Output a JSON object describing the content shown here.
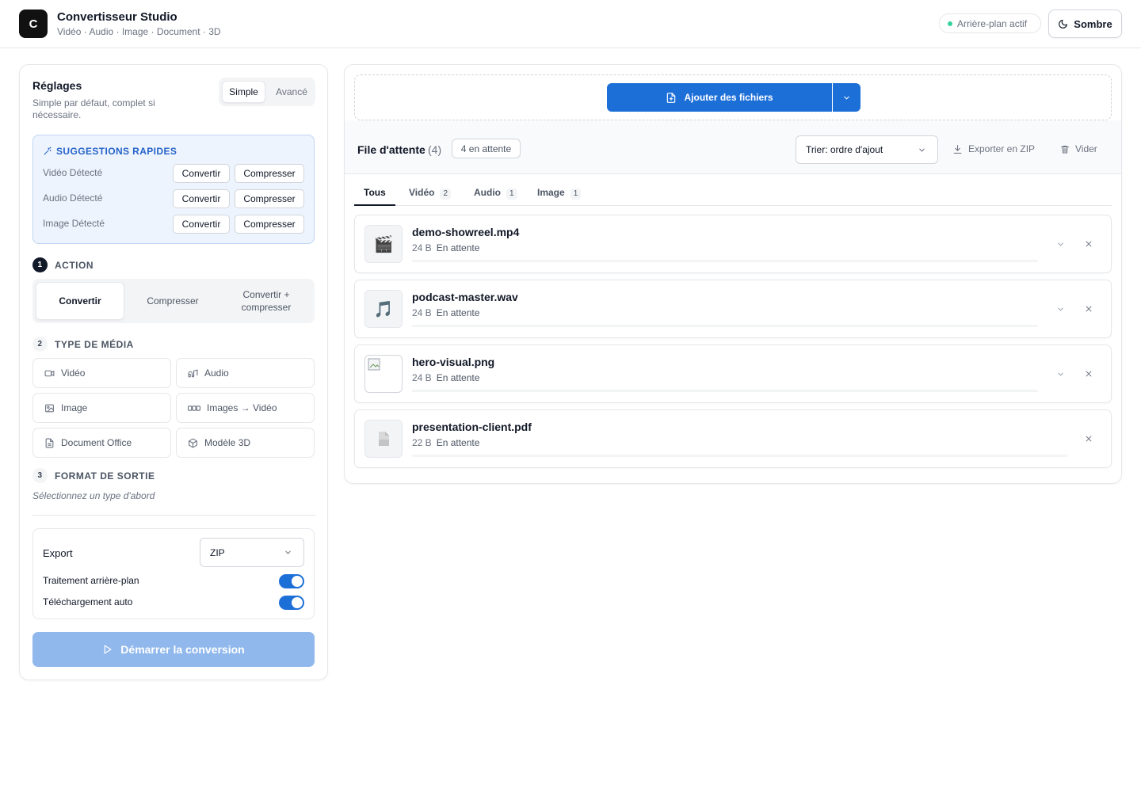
{
  "header": {
    "logo_letter": "C",
    "title": "Convertisseur Studio",
    "subtitle": "Vidéo · Audio · Image · Document · 3D",
    "background_status": "Arrière-plan actif",
    "theme_button": "Sombre"
  },
  "settings": {
    "title": "Réglages",
    "description": "Simple par défaut, complet si nécessaire.",
    "modes": [
      "Simple",
      "Avancé"
    ],
    "selected_mode": "Simple",
    "suggestions": {
      "title": "SUGGESTIONS RAPIDES",
      "rows": [
        {
          "label": "Vidéo Détecté",
          "convert": "Convertir",
          "compress": "Compresser"
        },
        {
          "label": "Audio Détecté",
          "convert": "Convertir",
          "compress": "Compresser"
        },
        {
          "label": "Image Détecté",
          "convert": "Convertir",
          "compress": "Compresser"
        }
      ]
    },
    "steps": [
      {
        "num": "1",
        "title": "ACTION"
      },
      {
        "num": "2",
        "title": "TYPE DE MÉDIA"
      },
      {
        "num": "3",
        "title": "FORMAT DE SORTIE"
      }
    ],
    "actions": [
      "Convertir",
      "Compresser",
      "Convertir + compresser"
    ],
    "selected_action": "Convertir",
    "media_types": [
      {
        "label": "Vidéo",
        "icon": "video-icon"
      },
      {
        "label": "Audio",
        "icon": "audio-icon"
      },
      {
        "label": "Image",
        "icon": "image-icon"
      },
      {
        "label": "Images → Vidéo",
        "icon": "image-sequence-icon"
      },
      {
        "label": "Document Office",
        "icon": "document-icon"
      },
      {
        "label": "Modèle 3D",
        "icon": "cube-icon"
      }
    ],
    "format_hint": "Sélectionnez un type d'abord",
    "export": {
      "label": "Export",
      "value": "ZIP",
      "background_processing": {
        "label": "Traitement arrière-plan",
        "enabled": true
      },
      "auto_download": {
        "label": "Téléchargement auto",
        "enabled": true
      }
    },
    "start_button": "Démarrer la conversion"
  },
  "queue": {
    "add_button": "Ajouter des fichiers",
    "title": "File d'attente",
    "count": "(4)",
    "pending_badge": "4 en attente",
    "sort": "Trier: ordre d'ajout",
    "export_zip": "Exporter en ZIP",
    "clear": "Vider",
    "tabs": [
      {
        "label": "Tous",
        "count": ""
      },
      {
        "label": "Vidéo",
        "count": "2"
      },
      {
        "label": "Audio",
        "count": "1"
      },
      {
        "label": "Image",
        "count": "1"
      }
    ],
    "selected_tab": "Tous",
    "files": [
      {
        "name": "demo-showreel.mp4",
        "size": "24 B",
        "status": "En attente",
        "icon": "clapperboard-icon",
        "glyph": "🎬"
      },
      {
        "name": "podcast-master.wav",
        "size": "24 B",
        "status": "En attente",
        "icon": "music-note-icon",
        "glyph": "🎵"
      },
      {
        "name": "hero-visual.png",
        "size": "24 B",
        "status": "En attente",
        "icon": "broken-image-icon",
        "glyph": ""
      },
      {
        "name": "presentation-client.pdf",
        "size": "22 B",
        "status": "En attente",
        "icon": "file-icon",
        "glyph": ""
      }
    ]
  },
  "colors": {
    "accent": "#1d6fd8",
    "accent_disabled": "#90b8ec",
    "suggest_bg": "#eef4fd",
    "status_dot": "#34d399"
  }
}
